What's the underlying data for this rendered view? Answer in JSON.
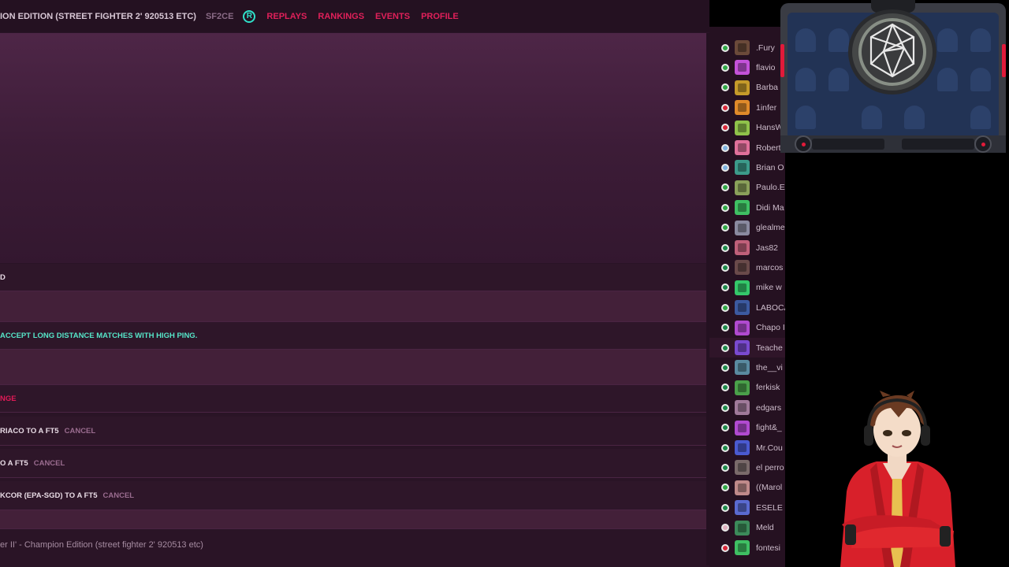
{
  "topbar": {
    "game_title": "ION EDITION (STREET FIGHTER 2' 920513 ETC)",
    "game_code": "SF2CE",
    "logo_letter": "R",
    "nav": [
      "REPLAYS",
      "RANKINGS",
      "EVENTS",
      "PROFILE"
    ]
  },
  "rows": {
    "r1": "D",
    "r2": "ACCEPT LONG DISTANCE MATCHES WITH HIGH PING.",
    "r3": "NGE",
    "challenge1": {
      "text": "RIACO TO A FT5",
      "cancel": "CANCEL"
    },
    "challenge2": {
      "text": "O A FT5",
      "cancel": "CANCEL"
    },
    "challenge3": {
      "text": "KCOR (EPA-SGD) TO A FT5",
      "cancel": "CANCEL"
    }
  },
  "footer_text": "er II' - Champion Edition (street fighter 2' 920513 etc)",
  "players": [
    {
      "name": ".Fury",
      "flag": "#31a846",
      "avatar": "#6b4a3a"
    },
    {
      "name": "flavio",
      "flag": "#31a846",
      "avatar": "#c452d9"
    },
    {
      "name": "Barba",
      "flag": "#31a846",
      "avatar": "#c59a2a"
    },
    {
      "name": "1infer",
      "flag": "#d8283a",
      "avatar": "#e08a2a"
    },
    {
      "name": "HansW",
      "flag": "#d8283a",
      "avatar": "#8fc24a"
    },
    {
      "name": "Robert",
      "flag": "#7fb3e0",
      "avatar": "#e0709a"
    },
    {
      "name": "Brian O",
      "flag": "#7fb3e0",
      "avatar": "#3c9a8a"
    },
    {
      "name": "Paulo.E",
      "flag": "#31a846",
      "avatar": "#8aa05a"
    },
    {
      "name": "Didi Ma",
      "flag": "#31a846",
      "avatar": "#3fbf63"
    },
    {
      "name": "glealme",
      "flag": "#31a846",
      "avatar": "#8a8aa0"
    },
    {
      "name": "Jas82",
      "flag": "#1e8a4a",
      "avatar": "#c0607a"
    },
    {
      "name": "marcos",
      "flag": "#1e8a4a",
      "avatar": "#6a4a4a"
    },
    {
      "name": "mike w",
      "flag": "#1e8a4a",
      "avatar": "#34c76a"
    },
    {
      "name": "LABOCA",
      "flag": "#31a846",
      "avatar": "#3c5aa0"
    },
    {
      "name": "Chapo I",
      "flag": "#1e8a4a",
      "avatar": "#b04ad0"
    },
    {
      "name": "Teache",
      "flag": "#1e8a4a",
      "avatar": "#7a4ad0"
    },
    {
      "name": "the__vi",
      "flag": "#1e8a4a",
      "avatar": "#5a8aa0"
    },
    {
      "name": "ferkisk",
      "flag": "#1e8a4a",
      "avatar": "#4aa04a"
    },
    {
      "name": "edgars",
      "flag": "#1e8a4a",
      "avatar": "#a07a9a"
    },
    {
      "name": "fight&_",
      "flag": "#1e8a4a",
      "avatar": "#b04ad0"
    },
    {
      "name": "Mr.Cou",
      "flag": "#1e8a4a",
      "avatar": "#4a5ad0"
    },
    {
      "name": "el perro",
      "flag": "#1e8a4a",
      "avatar": "#7a6a6a"
    },
    {
      "name": "((Marol",
      "flag": "#31a846",
      "avatar": "#c08a8a"
    },
    {
      "name": "ESELE S",
      "flag": "#1e8a4a",
      "avatar": "#5a6ad0"
    },
    {
      "name": "Meld",
      "flag": "#e0b0c0",
      "avatar": "#3c8a5a"
    },
    {
      "name": "fontesi",
      "flag": "#d8283a",
      "avatar": "#3fbf63"
    }
  ],
  "highlighted_player_index": 15,
  "colors": {
    "accent_red": "#e0205a",
    "accent_teal": "#56e6c9",
    "lobby_bg": "#2a1426"
  }
}
